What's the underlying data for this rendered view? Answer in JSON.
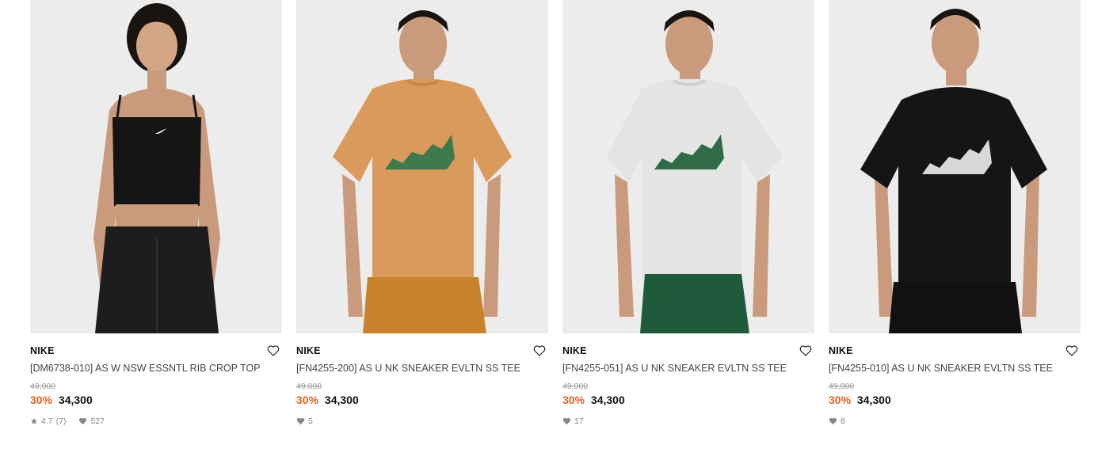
{
  "products": [
    {
      "brand": "NIKE",
      "name": "[DM6738-010] AS W NSW ESSNTL RIB CROP TOP",
      "original_price": "49,000",
      "discount": "30%",
      "price": "34,300",
      "rating": "4.7",
      "review_count": "(7)",
      "likes": "527",
      "top_color": "#151515",
      "bottom_color": "#1d1d1d"
    },
    {
      "brand": "NIKE",
      "name": "[FN4255-200] AS U NK SNEAKER EVLTN SS TEE",
      "original_price": "49,000",
      "discount": "30%",
      "price": "34,300",
      "likes": "5",
      "top_color": "#d99a5c",
      "bottom_color": "#c8822c"
    },
    {
      "brand": "NIKE",
      "name": "[FN4255-051] AS U NK SNEAKER EVLTN SS TEE",
      "original_price": "49,000",
      "discount": "30%",
      "price": "34,300",
      "likes": "17",
      "top_color": "#e4e4e2",
      "bottom_color": "#1f5a3a"
    },
    {
      "brand": "NIKE",
      "name": "[FN4255-010] AS U NK SNEAKER EVLTN SS TEE",
      "original_price": "49,000",
      "discount": "30%",
      "price": "34,300",
      "likes": "8",
      "top_color": "#151515",
      "bottom_color": "#111111"
    }
  ],
  "colors": {
    "accent_discount": "#e8601c",
    "photo_bg": "#ececec",
    "skin": "#c99a7c",
    "hair": "#1a1410"
  }
}
